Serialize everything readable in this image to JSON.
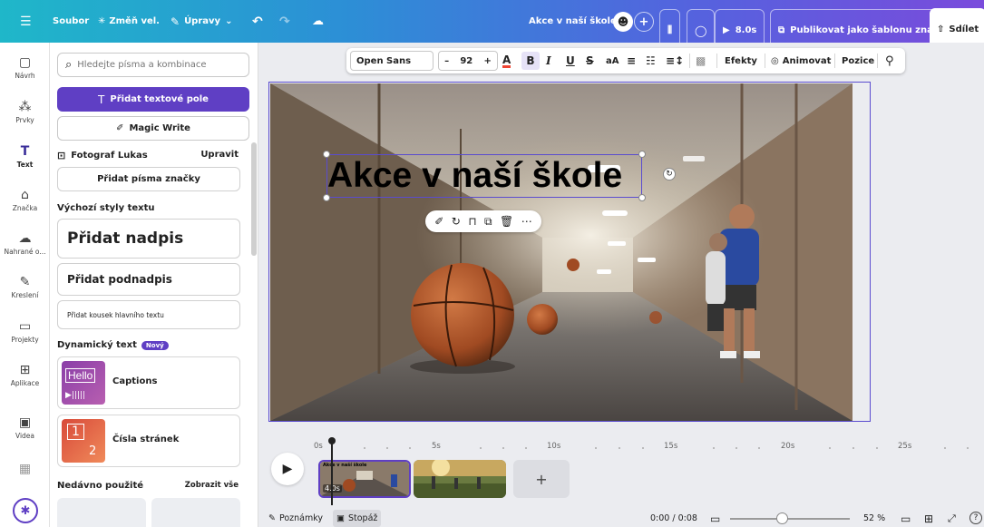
{
  "topbar": {
    "file": "Soubor",
    "resize": "Změň vel.",
    "editing": "Úpravy",
    "doc_title": "Akce v naší škole",
    "duration": "8.0s",
    "publish_template": "Publikovat jako šablonu značky",
    "share": "Sdílet"
  },
  "rail": {
    "items": [
      {
        "label": "Návrh",
        "icon": "layout-icon"
      },
      {
        "label": "Prvky",
        "icon": "shapes-icon"
      },
      {
        "label": "Text",
        "icon": "text-icon"
      },
      {
        "label": "Značka",
        "icon": "brand-icon"
      },
      {
        "label": "Nahrané o...",
        "icon": "upload-icon"
      },
      {
        "label": "Kreslení",
        "icon": "draw-icon"
      },
      {
        "label": "Projekty",
        "icon": "folder-icon"
      },
      {
        "label": "Aplikace",
        "icon": "apps-icon"
      },
      {
        "label": "Videa",
        "icon": "video-icon"
      }
    ]
  },
  "panel": {
    "search_placeholder": "Hledejte písma a kombinace",
    "add_textbox": "Přidat textové pole",
    "magic_write": "Magic Write",
    "brand_kit_name": "Fotograf Lukas",
    "edit": "Upravit",
    "add_brand_fonts": "Přidat písma značky",
    "default_styles": "Výchozí styly textu",
    "add_heading": "Přidat nadpis",
    "add_subheading": "Přidat podnadpis",
    "add_body": "Přidat kousek hlavního textu",
    "dynamic_text": "Dynamický text",
    "new_badge": "Nový",
    "captions": "Captions",
    "captions_thumb": "Hello",
    "page_numbers": "Čísla stránek",
    "page_numbers_thumb_a": "1",
    "page_numbers_thumb_b": "2",
    "recently_used": "Nedávno použité",
    "see_all": "Zobrazit vše"
  },
  "text_toolbar": {
    "font": "Open Sans",
    "font_size": "92",
    "case_label": "aA",
    "effects": "Efekty",
    "animate": "Animovat",
    "position": "Pozice"
  },
  "canvas": {
    "title": "Akce v naší škole"
  },
  "timeline": {
    "ticks": [
      "0s",
      "5s",
      "10s",
      "15s",
      "20s",
      "25s"
    ],
    "clip_duration": "4.0s",
    "clip_caption": "Akce v naší škole"
  },
  "bottombar": {
    "notes": "Poznámky",
    "timeline": "Stopáž",
    "time": "0:00 / 0:08",
    "zoom": "52 %",
    "help": "?"
  },
  "colors": {
    "accent": "#5f3fc4",
    "selection": "#5a4ccf"
  }
}
